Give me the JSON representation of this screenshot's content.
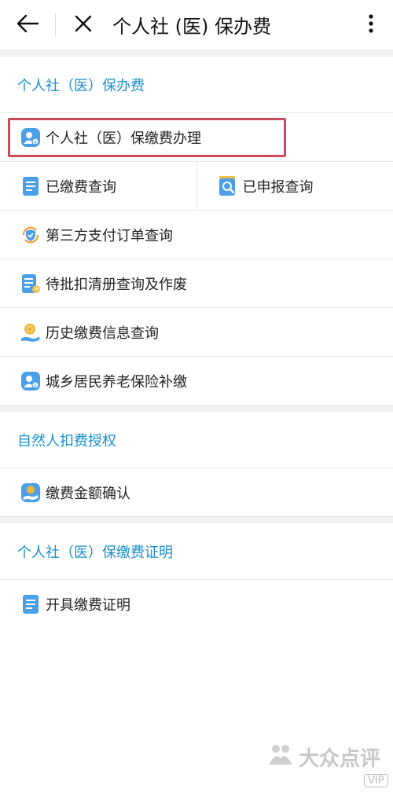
{
  "header": {
    "title": "个人社 (医) 保办费",
    "back_icon": "arrow-left-icon",
    "close_icon": "close-icon",
    "more_icon": "more-vertical-icon"
  },
  "sections": [
    {
      "title": "个人社（医）保办费",
      "items": [
        {
          "label": "个人社（医）保缴费办理",
          "icon": "person-badge-icon",
          "highlighted": true
        },
        {
          "label": "已缴费查询",
          "icon": "document-list-icon"
        },
        {
          "label": "已申报查询",
          "icon": "document-search-icon"
        },
        {
          "label": "第三方支付订单查询",
          "icon": "shield-cycle-icon"
        },
        {
          "label": "待批扣清册查询及作废",
          "icon": "document-clock-icon"
        },
        {
          "label": "历史缴费信息查询",
          "icon": "coin-hand-icon"
        },
        {
          "label": "城乡居民养老保险补缴",
          "icon": "person-badge-icon"
        }
      ]
    },
    {
      "title": "自然人扣费授权",
      "items": [
        {
          "label": "缴费金额确认",
          "icon": "coin-hand-icon"
        }
      ]
    },
    {
      "title": "个人社（医）保缴费证明",
      "items": [
        {
          "label": "开具缴费证明",
          "icon": "document-list-icon"
        }
      ]
    }
  ],
  "watermark": {
    "brand": "大众点评",
    "tag": "VIP"
  },
  "colors": {
    "accent": "#1c8fce",
    "highlight_border": "#cf4a59",
    "icon_blue": "#4a9fe6"
  }
}
